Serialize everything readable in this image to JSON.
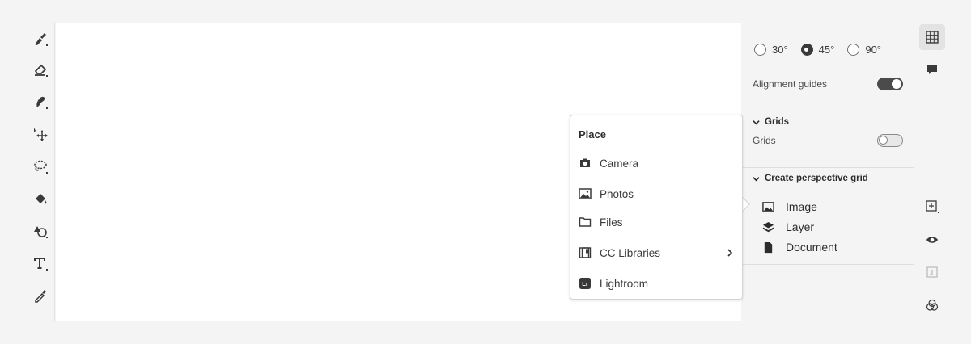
{
  "left_toolbar": {
    "tools": [
      {
        "name": "brush-tool",
        "icon": "brush-icon"
      },
      {
        "name": "eraser-tool",
        "icon": "eraser-icon"
      },
      {
        "name": "smudge-tool",
        "icon": "smudge-icon"
      },
      {
        "name": "transform-tool",
        "icon": "transform-icon"
      },
      {
        "name": "lasso-tool",
        "icon": "lasso-icon"
      },
      {
        "name": "fill-tool",
        "icon": "paint-bucket-icon"
      },
      {
        "name": "shape-tool",
        "icon": "shapes-icon"
      },
      {
        "name": "text-tool",
        "icon": "text-icon"
      },
      {
        "name": "eyedropper-tool",
        "icon": "eyedropper-icon"
      }
    ]
  },
  "panel": {
    "angles": [
      {
        "label": "30°",
        "checked": false
      },
      {
        "label": "45°",
        "checked": true
      },
      {
        "label": "90°",
        "checked": false
      }
    ],
    "alignment_guides": {
      "label": "Alignment guides",
      "on": true
    },
    "grids_section": {
      "title": "Grids",
      "row_label": "Grids",
      "on": false
    },
    "create_section": {
      "title": "Create perspective grid",
      "items": [
        {
          "label": "Image",
          "icon": "image-icon"
        },
        {
          "label": "Layer",
          "icon": "layers-icon"
        },
        {
          "label": "Document",
          "icon": "document-icon"
        }
      ]
    }
  },
  "popover": {
    "title": "Place",
    "items": [
      {
        "label": "Camera",
        "icon": "camera-icon",
        "submenu": false
      },
      {
        "label": "Photos",
        "icon": "photos-icon",
        "submenu": false
      },
      {
        "label": "Files",
        "icon": "folder-icon",
        "submenu": false
      },
      {
        "label": "CC Libraries",
        "icon": "libraries-icon",
        "submenu": true
      },
      {
        "label": "Lightroom",
        "icon": "lightroom-icon",
        "submenu": false
      }
    ]
  },
  "right_rail": {
    "buttons": [
      {
        "name": "grid-panel-button",
        "icon": "grid-icon",
        "active": true
      },
      {
        "name": "comments-button",
        "icon": "comment-icon",
        "active": false
      },
      {
        "name": "add-layer-button",
        "icon": "add-square-icon",
        "active": false
      },
      {
        "name": "visibility-button",
        "icon": "eye-icon",
        "active": false
      },
      {
        "name": "merge-button",
        "icon": "merge-icon",
        "active": false
      },
      {
        "name": "blend-button",
        "icon": "blend-icon",
        "active": false
      }
    ]
  },
  "colors": {
    "background": "#f4f4f4",
    "canvas": "#ffffff",
    "icon": "#3a3a3a",
    "divider": "#dedede"
  }
}
